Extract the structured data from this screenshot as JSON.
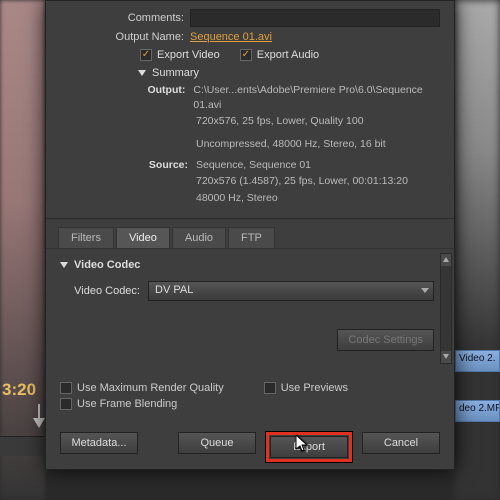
{
  "timeline": {
    "timecode": "3:20",
    "clip1_label": "Video 2.",
    "clip2_label": "deo 2.MP"
  },
  "form": {
    "comments_label": "Comments:",
    "comments_value": "",
    "output_name_label": "Output Name:",
    "output_name_value": "Sequence 01.avi"
  },
  "checks": {
    "export_video": "Export Video",
    "export_audio": "Export Audio"
  },
  "summary": {
    "title": "Summary",
    "output_label": "Output:",
    "output_line1": "C:\\User...ents\\Adobe\\Premiere Pro\\6.0\\Sequence 01.avi",
    "output_line2": "720x576, 25 fps, Lower, Quality 100",
    "output_line3": "Uncompressed, 48000 Hz, Stereo, 16 bit",
    "source_label": "Source:",
    "source_line1": "Sequence, Sequence 01",
    "source_line2": "720x576 (1.4587), 25 fps, Lower, 00:01:13:20",
    "source_line3": "48000 Hz, Stereo"
  },
  "tabs": {
    "filters": "Filters",
    "video": "Video",
    "audio": "Audio",
    "ftp": "FTP"
  },
  "codec": {
    "section_title": "Video Codec",
    "label": "Video Codec:",
    "value": "DV PAL",
    "settings_btn": "Codec Settings"
  },
  "lower_checks": {
    "max_quality": "Use Maximum Render Quality",
    "previews": "Use Previews",
    "frame_blend": "Use Frame Blending"
  },
  "buttons": {
    "metadata": "Metadata...",
    "queue": "Queue",
    "export": "Export",
    "cancel": "Cancel"
  }
}
